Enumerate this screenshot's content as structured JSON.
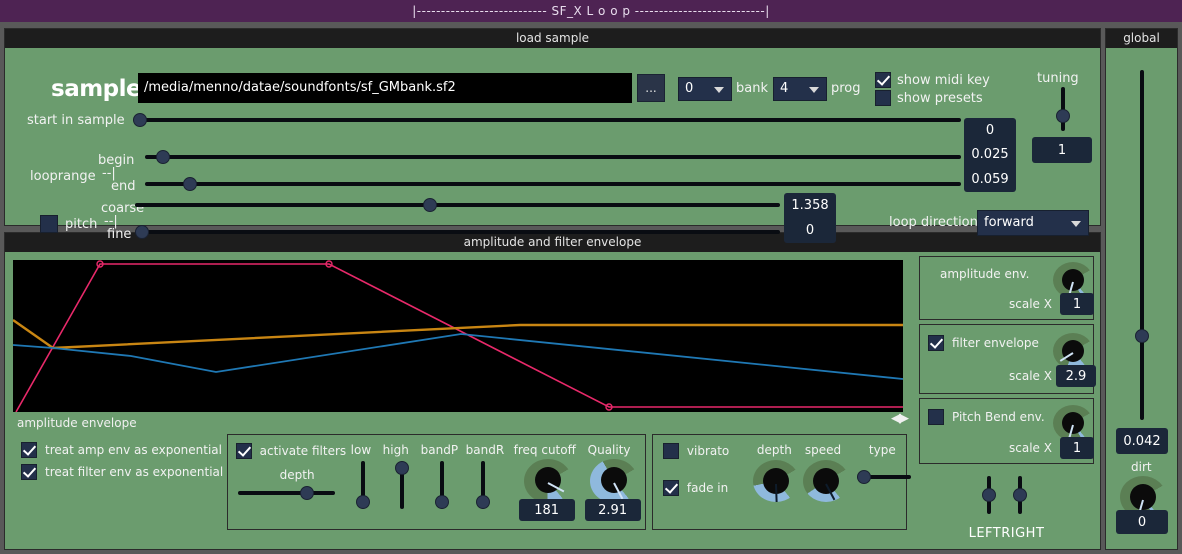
{
  "window": {
    "title": "|--------------------------- SF_X L o o p ---------------------------|"
  },
  "load_sample": {
    "panel_title": "load sample",
    "sample_label": "sample",
    "sample_path": "/media/menno/datae/soundfonts/sf_GMbank.sf2",
    "browse_label": "...",
    "bank": {
      "value": "0",
      "label": "bank"
    },
    "prog": {
      "value": "4",
      "label": "prog"
    },
    "show_midi_key": {
      "label": "show midi key",
      "checked": true
    },
    "show_presets": {
      "label": "show presets",
      "checked": false
    },
    "start_in_sample": {
      "label": "start in sample",
      "value": "0"
    },
    "looprange": {
      "label": "looprange",
      "bracket": "--|",
      "begin_label": "begin",
      "end_label": "end",
      "begin_value": "0.025",
      "end_value": "0.059"
    },
    "pitch": {
      "label": "pitch",
      "bracket": "--|",
      "checked": false,
      "coarse_label": "coarse",
      "fine_label": "fine",
      "coarse_value": "1.358",
      "fine_value": "0"
    },
    "loop_direction": {
      "label": "loop direction",
      "value": "forward"
    },
    "tuning": {
      "label": "tuning",
      "value": "1"
    }
  },
  "envelope": {
    "panel_title": "amplitude and filter envelope",
    "graph_label": "amplitude envelope",
    "scroll_icon": "left-right-arrows",
    "amplitude_env": {
      "label": "amplitude env.",
      "scale_label": "scale X",
      "scale_value": "1"
    },
    "filter_env": {
      "label": "filter envelope",
      "checked": true,
      "scale_label": "scale X",
      "scale_value": "2.9"
    },
    "pitch_bend_env": {
      "label": "Pitch Bend env.",
      "checked": false,
      "scale_label": "scale X",
      "scale_value": "1"
    },
    "leftright_label": "LEFTRIGHT"
  },
  "bottom": {
    "treat_amp_exp": {
      "label": "treat amp env as exponential",
      "checked": true
    },
    "treat_filter_exp": {
      "label": "treat filter env as exponential",
      "checked": true
    },
    "filters": {
      "activate_label": "activate filters",
      "activate_checked": true,
      "depth_label": "depth",
      "low_label": "low",
      "high_label": "high",
      "bandp_label": "bandP",
      "bandr_label": "bandR",
      "freq_cutoff_label": "freq cutoff",
      "freq_cutoff_value": "181",
      "quality_label": "Quality",
      "quality_value": "2.91"
    },
    "vibrato": {
      "label": "vibrato",
      "checked": false,
      "fade_in_label": "fade in",
      "fade_in_checked": true,
      "depth_label": "depth",
      "speed_label": "speed",
      "type_label": "type"
    }
  },
  "global": {
    "panel_title": "global",
    "volume_value": "0.042",
    "dirt_label": "dirt",
    "dirt_value": "0"
  },
  "colors": {
    "panel_green": "#6b9c6e",
    "title_dark": "#1d1d1d",
    "titlebar_purple": "#4e2353",
    "value_navy": "#1b2739",
    "curve_red": "#e8296a",
    "curve_orange": "#c98613",
    "curve_blue": "#1f78b4"
  },
  "chart_data": {
    "type": "line",
    "title": "amplitude envelope",
    "xlabel": "",
    "ylabel": "",
    "xlim": [
      0,
      100
    ],
    "ylim": [
      0,
      100
    ],
    "grid": false,
    "legend": "none",
    "series": [
      {
        "name": "amplitude envelope",
        "color": "#e8296a",
        "x": [
          0.3,
          9.8,
          35.5,
          67.0,
          100
        ],
        "y": [
          0,
          99,
          99,
          3,
          3
        ]
      },
      {
        "name": "filter envelope",
        "color": "#c98613",
        "x": [
          0,
          4.5,
          57.0,
          100
        ],
        "y": [
          60,
          42,
          57,
          57
        ]
      },
      {
        "name": "pitch bend envelope",
        "color": "#1f78b4",
        "x": [
          0,
          4.5,
          13.0,
          23.0,
          50.5,
          100
        ],
        "y": [
          44,
          42,
          38,
          26,
          51,
          22
        ]
      }
    ]
  }
}
